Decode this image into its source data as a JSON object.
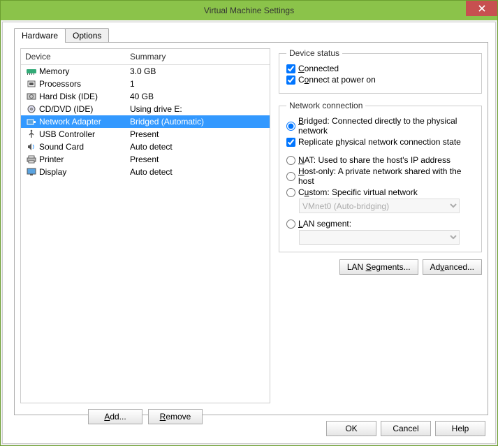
{
  "title": "Virtual Machine Settings",
  "tabs": {
    "hardware": "Hardware",
    "options": "Options"
  },
  "headers": {
    "device": "Device",
    "summary": "Summary"
  },
  "devices": [
    {
      "name": "Memory",
      "summary": "3.0 GB",
      "icon": "memory"
    },
    {
      "name": "Processors",
      "summary": "1",
      "icon": "cpu"
    },
    {
      "name": "Hard Disk (IDE)",
      "summary": "40 GB",
      "icon": "disk"
    },
    {
      "name": "CD/DVD (IDE)",
      "summary": "Using drive E:",
      "icon": "cd"
    },
    {
      "name": "Network Adapter",
      "summary": "Bridged (Automatic)",
      "icon": "nic"
    },
    {
      "name": "USB Controller",
      "summary": "Present",
      "icon": "usb"
    },
    {
      "name": "Sound Card",
      "summary": "Auto detect",
      "icon": "sound"
    },
    {
      "name": "Printer",
      "summary": "Present",
      "icon": "printer"
    },
    {
      "name": "Display",
      "summary": "Auto detect",
      "icon": "display"
    }
  ],
  "selected_device_index": 4,
  "buttons": {
    "add": "Add...",
    "remove": "Remove",
    "ok": "OK",
    "cancel": "Cancel",
    "help": "Help",
    "lanseg": "LAN Segments...",
    "advanced": "Advanced..."
  },
  "device_status": {
    "legend": "Device status",
    "connected": "Connected",
    "connect_power": "Connect at power on",
    "connected_checked": true,
    "connect_power_checked": true
  },
  "network": {
    "legend": "Network connection",
    "bridged": "Bridged: Connected directly to the physical network",
    "replicate": "Replicate physical network connection state",
    "nat": "NAT: Used to share the host's IP address",
    "hostonly": "Host-only: A private network shared with the host",
    "custom": "Custom: Specific virtual network",
    "vmnet_value": "VMnet0 (Auto-bridging)",
    "lanseg": "LAN segment:",
    "selected": "bridged",
    "replicate_checked": true
  }
}
